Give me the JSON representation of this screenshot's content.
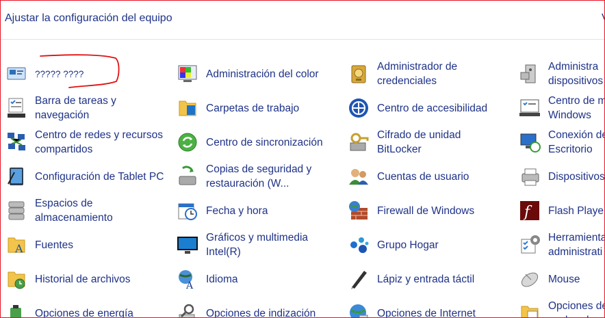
{
  "header": {
    "title": "Ajustar la configuración del equipo",
    "view_by_partial": "V"
  },
  "items": [
    {
      "label": "????? ????",
      "icon": "display-language-icon"
    },
    {
      "label": "Barra de tareas y\nnavegación",
      "icon": "taskbar-icon"
    },
    {
      "label": "Centro de redes y recursos\ncompartidos",
      "icon": "network-center-icon"
    },
    {
      "label": "Configuración de Tablet PC",
      "icon": "tablet-pc-icon"
    },
    {
      "label": "Espacios de\nalmacenamiento",
      "icon": "storage-spaces-icon"
    },
    {
      "label": "Fuentes",
      "icon": "fonts-folder-icon"
    },
    {
      "label": "Historial de archivos",
      "icon": "file-history-icon"
    },
    {
      "label": "Opciones de energía",
      "icon": "power-options-icon"
    },
    {
      "label": "Administración del color",
      "icon": "color-management-icon"
    },
    {
      "label": "Carpetas de trabajo",
      "icon": "work-folders-icon"
    },
    {
      "label": "Centro de sincronización",
      "icon": "sync-center-icon"
    },
    {
      "label": "Copias de seguridad y\nrestauración (W...",
      "icon": "backup-restore-icon"
    },
    {
      "label": "Fecha y hora",
      "icon": "calendar-clock-icon"
    },
    {
      "label": "Gráficos y multimedia\nIntel(R)",
      "icon": "intel-graphics-icon"
    },
    {
      "label": "Idioma",
      "icon": "language-icon"
    },
    {
      "label": "Opciones de indización",
      "icon": "indexing-options-icon"
    },
    {
      "label": "Administrador de\ncredenciales",
      "icon": "credential-manager-icon"
    },
    {
      "label": "Centro de accesibilidad",
      "icon": "accessibility-icon"
    },
    {
      "label": "Cifrado de unidad\nBitLocker",
      "icon": "bitlocker-icon"
    },
    {
      "label": "Cuentas de usuario",
      "icon": "user-accounts-icon"
    },
    {
      "label": "Firewall de Windows",
      "icon": "firewall-icon"
    },
    {
      "label": "Grupo Hogar",
      "icon": "homegroup-icon"
    },
    {
      "label": "Lápiz y entrada táctil",
      "icon": "pen-touch-icon"
    },
    {
      "label": "Opciones de Internet",
      "icon": "internet-options-icon"
    },
    {
      "label": "Administra\ndispositivos",
      "icon": "device-manager-icon"
    },
    {
      "label": "Centro de m\nWindows",
      "icon": "windows-mobility-center-icon"
    },
    {
      "label": "Conexión de\nEscritorio",
      "icon": "remote-desktop-icon"
    },
    {
      "label": "Dispositivos",
      "icon": "devices-printers-icon"
    },
    {
      "label": "Flash Player",
      "icon": "flash-player-icon"
    },
    {
      "label": "Herramienta\nadministrati",
      "icon": "admin-tools-icon"
    },
    {
      "label": "Mouse",
      "icon": "mouse-icon"
    },
    {
      "label": "Opciones de\nexplorador",
      "icon": "folder-options-icon"
    }
  ]
}
